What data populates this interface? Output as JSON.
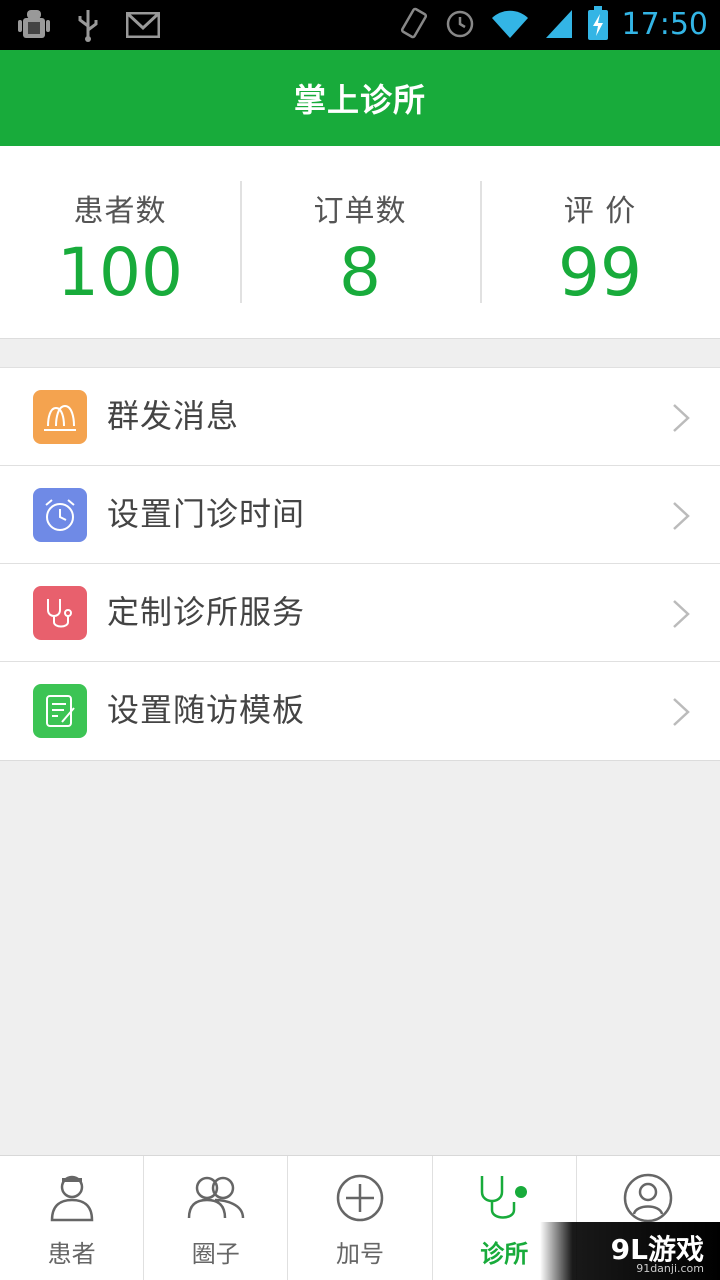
{
  "status_bar": {
    "time": "17:50",
    "icons": [
      "android-debug-icon",
      "usb-icon",
      "gmail-icon",
      "vibrate-icon",
      "alarm-icon",
      "wifi-icon",
      "signal-icon",
      "battery-charging-icon"
    ],
    "accent_color": "#33b5e5"
  },
  "header": {
    "title": "掌上诊所",
    "background_color": "#18ab3b"
  },
  "stats": [
    {
      "label": "患者数",
      "value": "100"
    },
    {
      "label": "订单数",
      "value": "8"
    },
    {
      "label": "评 价",
      "value": "99"
    }
  ],
  "menu": {
    "items": [
      {
        "label": "群发消息",
        "icon": "group-message-icon",
        "icon_color": "#f4a34f"
      },
      {
        "label": "设置门诊时间",
        "icon": "alarm-clock-icon",
        "icon_color": "#6f8ae6"
      },
      {
        "label": "定制诊所服务",
        "icon": "stethoscope-icon",
        "icon_color": "#e8606d"
      },
      {
        "label": "设置随访模板",
        "icon": "edit-document-icon",
        "icon_color": "#3cc454"
      }
    ]
  },
  "tabbar": {
    "tabs": [
      {
        "label": "患者",
        "icon": "doctor-icon"
      },
      {
        "label": "圈子",
        "icon": "group-icon"
      },
      {
        "label": "加号",
        "icon": "add-circle-icon"
      },
      {
        "label": "诊所",
        "icon": "stethoscope-icon",
        "active": true
      },
      {
        "label": "",
        "icon": "profile-icon"
      }
    ],
    "active_color": "#18ab3b"
  },
  "watermark": {
    "text": "9L游戏",
    "sub": "91danji.com"
  }
}
